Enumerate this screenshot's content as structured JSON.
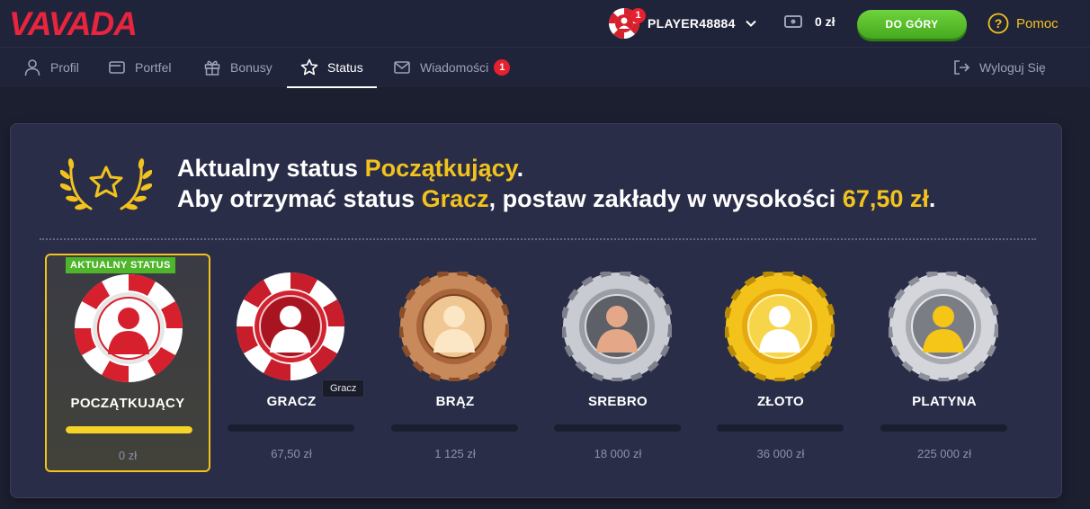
{
  "brand": {
    "logo_text": "VAVADA",
    "logo_color": "#e8243f"
  },
  "header": {
    "username": "PLAYER48884",
    "notification_count": "1",
    "balance": "0 zł",
    "deposit_label": "DO GÓRY",
    "help_label": "Pomoc",
    "help_icon": "question-circle-icon"
  },
  "tabs": [
    {
      "label": "Profil",
      "icon": "user-icon"
    },
    {
      "label": "Portfel",
      "icon": "wallet-icon"
    },
    {
      "label": "Bonusy",
      "icon": "gift-icon"
    },
    {
      "label": "Status",
      "icon": "star-icon",
      "active": true
    },
    {
      "label": "Wiadomości",
      "icon": "envelope-icon",
      "badge": "1"
    }
  ],
  "logout_label": "Wyloguj Się",
  "status": {
    "line1_prefix": "Aktualny status ",
    "current_status": "Początkujący",
    "line1_suffix": ".",
    "line2_prefix": "Aby otrzymać status ",
    "next_status": "Gracz",
    "line2_middle": ", postaw zakłady w wysokości ",
    "required_amount": "67,50 zł",
    "line2_suffix": ".",
    "current_badge": "AKTUALNY STATUS",
    "tooltip": "Gracz"
  },
  "levels": [
    {
      "name": "POCZĄTKUJĄCY",
      "amount": "0 zł",
      "progress": 1.0,
      "current": true
    },
    {
      "name": "GRACZ",
      "amount": "67,50 zł",
      "progress": 0
    },
    {
      "name": "BRĄZ",
      "amount": "1 125 zł",
      "progress": 0
    },
    {
      "name": "SREBRO",
      "amount": "18 000 zł",
      "progress": 0
    },
    {
      "name": "ZŁOTO",
      "amount": "36 000 zł",
      "progress": 0
    },
    {
      "name": "PLATYNA",
      "amount": "225 000 zł",
      "progress": 0
    }
  ],
  "colors": {
    "accent_yellow": "#f2c21d",
    "deposit_green": "#4fb52a",
    "badge_red": "#e6202f"
  }
}
